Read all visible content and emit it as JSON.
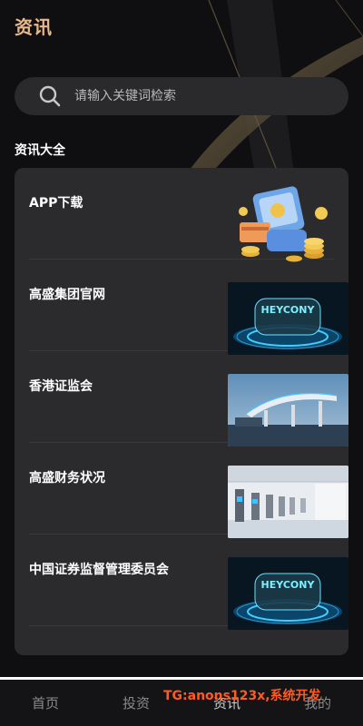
{
  "header": {
    "title": "资讯"
  },
  "search": {
    "placeholder": "请输入关键词检索"
  },
  "section": {
    "title": "资讯大全"
  },
  "news": [
    {
      "title": "APP下载",
      "image": "coins-phone-illustration"
    },
    {
      "title": "高盛集团官网",
      "image": "heycony-glowing-dome"
    },
    {
      "title": "香港证监会",
      "image": "charging-station-canopy"
    },
    {
      "title": "高盛财务状况",
      "image": "ev-chargers-hall"
    },
    {
      "title": "中国证券监督管理委员会",
      "image": "heycony-glowing-dome"
    }
  ],
  "thumb_text": "HEYCONY",
  "tabs": [
    {
      "label": "首页"
    },
    {
      "label": "投资"
    },
    {
      "label": "资讯"
    },
    {
      "label": "我的"
    }
  ],
  "watermark": "TG:anons123x,系统开发",
  "colors": {
    "accent": "#e7b98a",
    "watermark": "#ff5a1f",
    "card": "#2b2b2e"
  }
}
